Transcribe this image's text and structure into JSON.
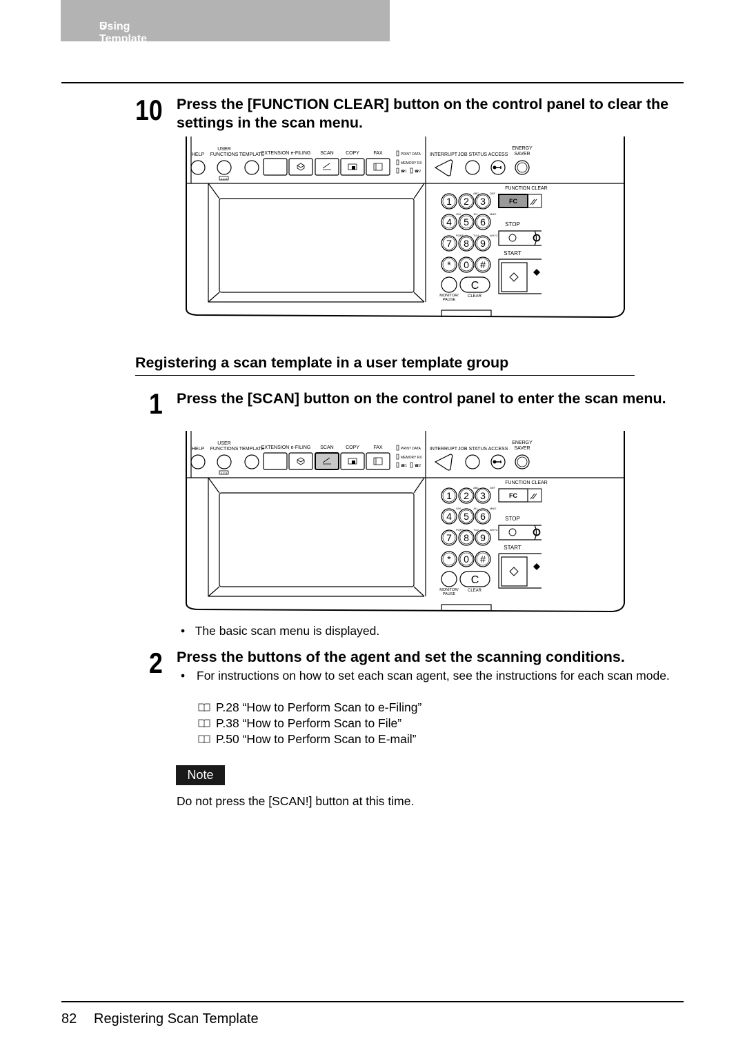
{
  "header": {
    "chapter": "5",
    "title": "Using Template"
  },
  "step10": {
    "number": "10",
    "text": "Press the [FUNCTION CLEAR] button on the control panel to clear the settings in the scan menu."
  },
  "section": {
    "title": "Registering a scan template in a user template group"
  },
  "step1": {
    "number": "1",
    "text": "Press the [SCAN] button on the control panel to enter the scan menu.",
    "bullet": "The basic scan menu is displayed."
  },
  "step2": {
    "number": "2",
    "text": "Press the buttons of the agent and set the scanning conditions.",
    "bullet": "For instructions on how to set each scan agent, see the instructions for each scan mode.",
    "refs": [
      {
        "icon": "book-icon",
        "text": "P.28 “How to Perform Scan to e-Filing”"
      },
      {
        "icon": "book-icon",
        "text": "P.38 “How to Perform Scan to File”"
      },
      {
        "icon": "book-icon",
        "text": "P.50 “How to Perform Scan to E-mail”"
      }
    ]
  },
  "note": {
    "label": "Note",
    "text": "Do not press the [SCAN!] button at this time."
  },
  "footer": {
    "page": "82",
    "title": "Registering Scan Template"
  },
  "panel": {
    "help": "HELP",
    "user_functions": [
      "USER",
      "FUNCTIONS"
    ],
    "template": "TEMPLATE",
    "counter": "1 2 3",
    "modes": [
      "EXTENSION",
      "e-FILING",
      "SCAN",
      "COPY",
      "FAX"
    ],
    "indicators": [
      "PRINT DATA",
      "MEMORY RX",
      "1",
      "2"
    ],
    "interrupt": "INTERRUPT",
    "job_status": "JOB STATUS",
    "access": "ACCESS",
    "energy_saver": [
      "ENERGY",
      "SAVER"
    ],
    "keys": [
      "1",
      "2",
      "3",
      "4",
      "5",
      "6",
      "7",
      "8",
      "9",
      "*",
      "0",
      "#"
    ],
    "key_letters": [
      "",
      "ABC",
      "DEF",
      "GHI",
      "JKL",
      "MNO",
      "PQRS",
      "TUV",
      "WXYZ",
      "",
      "",
      ""
    ],
    "function_clear": "FUNCTION CLEAR",
    "fc": "FC",
    "stop": "STOP",
    "start": "START",
    "monitor_pause": [
      "MONITOR/",
      "PAUSE"
    ],
    "clear_key": "C",
    "clear": "CLEAR",
    "highlight_panel1": "FC",
    "highlight_panel2": "SCAN"
  }
}
